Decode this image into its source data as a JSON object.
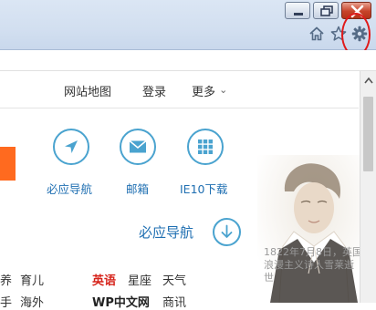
{
  "nav": {
    "sitemap": "网站地图",
    "login": "登录",
    "more": "更多",
    "more_arrow": "⌄"
  },
  "quick_links": [
    {
      "label": "必应导航",
      "icon": "navigation-arrow-icon"
    },
    {
      "label": "邮箱",
      "icon": "mail-icon"
    },
    {
      "label": "IE10下载",
      "icon": "grid-icon"
    }
  ],
  "section": {
    "title": "必应导航",
    "icon": "circle-down-arrow-icon"
  },
  "links": {
    "row1": [
      "养",
      "育儿",
      "英语",
      "星座",
      "天气"
    ],
    "row2": [
      "手",
      "海外",
      "WP中文网",
      "商讯"
    ]
  },
  "caption": {
    "lines": [
      "1822年7月8日，英国",
      "浪漫主义诗人雪莱逝",
      "世"
    ]
  },
  "colors": {
    "accent": "#4aa3cf",
    "link": "#1f6fb2",
    "highlight": "#d6231a",
    "orange": "#ff6a1f",
    "annotation": "#e01b1b"
  },
  "toolbar_icons": [
    "home-icon",
    "star-icon",
    "gear-icon"
  ]
}
